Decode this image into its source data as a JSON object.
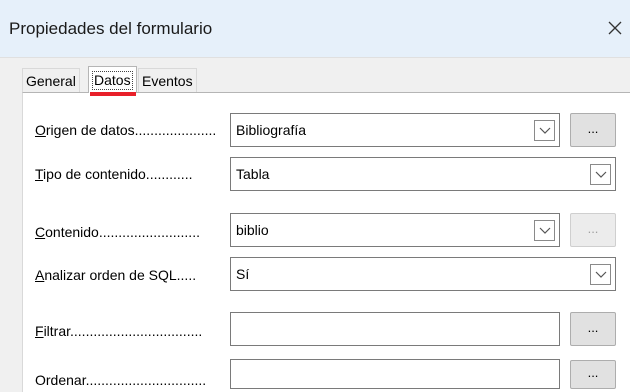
{
  "window": {
    "title": "Propiedades del formulario",
    "close_glyph": "✕"
  },
  "tabs": [
    {
      "label": "General",
      "active": false
    },
    {
      "label": "Datos",
      "active": true
    },
    {
      "label": "Eventos",
      "active": false
    }
  ],
  "fields": {
    "origen": {
      "label_accel": "O",
      "label_rest": "rigen de datos.....................",
      "value": "Bibliografía",
      "ellipsis": "..."
    },
    "tipo": {
      "label_accel": "T",
      "label_rest": "ipo de contenido............",
      "value": "Tabla"
    },
    "contenido": {
      "label_accel": "C",
      "label_rest": "ontenido..........................",
      "value": "biblio",
      "ellipsis": "..."
    },
    "analizar": {
      "label_accel": "A",
      "label_rest": "nalizar orden de SQL.....",
      "value": "Sí"
    },
    "filtrar": {
      "label_accel": "F",
      "label_rest": "iltrar..................................",
      "value": "",
      "ellipsis": "..."
    },
    "ordenar": {
      "label_accel": "",
      "label_rest": "Ordenar...............................",
      "value": "",
      "ellipsis": "..."
    }
  },
  "icons": {
    "dropdown": "chevron-down-icon",
    "close": "close-icon"
  },
  "colors": {
    "titlebar_bg": "#e6f0fa",
    "active_tab_marker": "#e8202a"
  }
}
